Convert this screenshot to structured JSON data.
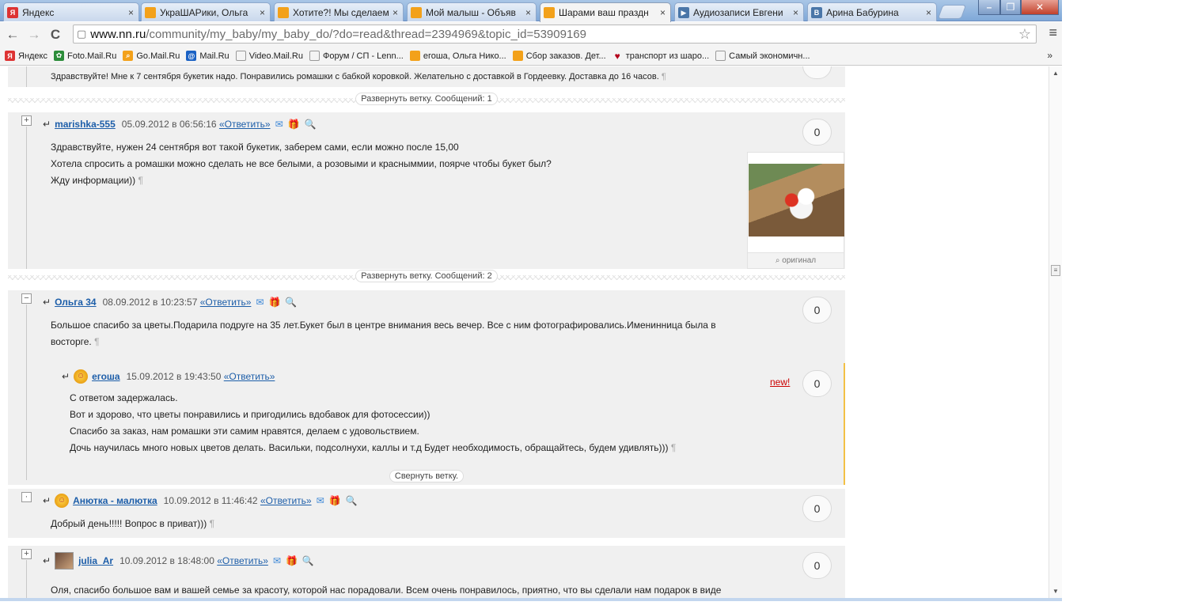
{
  "tabs": [
    {
      "label": "Яндекс",
      "fav": "Я",
      "fav_color": "#d33"
    },
    {
      "label": "УкраШАРики, Ольга",
      "fav": "",
      "fav_color": "#f3a11a"
    },
    {
      "label": "Хотите?! Мы сделаем",
      "fav": "",
      "fav_color": "#f3a11a"
    },
    {
      "label": "Мой малыш - Объяв",
      "fav": "",
      "fav_color": "#f3a11a"
    },
    {
      "label": "Шарами ваш праздн",
      "fav": "",
      "fav_color": "#f3a11a"
    },
    {
      "label": "Аудиозаписи Евгени",
      "fav": "▶",
      "fav_color": "#4a76a8"
    },
    {
      "label": "Арина Бабурина",
      "fav": "В",
      "fav_color": "#4a76a8"
    }
  ],
  "window": {
    "minimize": "–",
    "maximize": "❐",
    "close": "✕"
  },
  "toolbar": {
    "back": "←",
    "forward": "→",
    "reload": "C",
    "url_host": "www.nn.ru",
    "url_path": "/community/my_baby/my_baby_do/?do=read&thread=2394969&topic_id=53909169",
    "star": "☆",
    "menu": "≡"
  },
  "bookmarks": [
    {
      "label": "Яндекс",
      "ico": "Я",
      "color": "#d33"
    },
    {
      "label": "Foto.Mail.Ru",
      "ico": "✿",
      "color": "#2c8c3a"
    },
    {
      "label": "Go.Mail.Ru",
      "ico": "⌕",
      "color": "#f3a11a"
    },
    {
      "label": "Mail.Ru",
      "ico": "@",
      "color": "#1b62c4"
    },
    {
      "label": "Video.Mail.Ru",
      "ico": "▢",
      "color": "#999"
    },
    {
      "label": "Форум / СП - Lenn...",
      "ico": "▢",
      "color": "#999"
    },
    {
      "label": "егоша, Ольга Нико...",
      "ico": "",
      "color": "#f3a11a"
    },
    {
      "label": "Сбор заказов. Дет...",
      "ico": "",
      "color": "#f3a11a"
    },
    {
      "label": "транспорт из шаро...",
      "ico": "♥",
      "color": "#b3001b"
    },
    {
      "label": "Самый экономичн...",
      "ico": "▢",
      "color": "#999"
    }
  ],
  "bookmarks_more": "»",
  "top_post": {
    "text": "Здравствуйте! Мне к 7 сентября букетик надо. Понравились ромашки с бабкой коровкой. Желательно с доставкой в Гордеевку. Доставка до 16 часов."
  },
  "expand1": "Развернуть ветку. Сообщений: 1",
  "expand2": "Развернуть ветку. Сообщений: 2",
  "collapse": "Свернуть ветку.",
  "pilcrow": "¶",
  "reply_label": "«Ответить»",
  "posts": [
    {
      "toggle": "+",
      "author": "marishka-555",
      "date": "05.09.2012 в 06:56:16",
      "votes": "0",
      "lines": [
        "Здравствуйте, нужен 24 сентября вот такой букетик, заберем сами, если можно после 15,00",
        "Хотела спросить а ромашки можно сделать не все белыми, а розовыми и красныммии, поярче чтобы букет был?",
        "Жду информации))"
      ],
      "thumb_caption": "⌕ оригинал"
    },
    {
      "toggle": "−",
      "author": "Ольга 34",
      "date": "08.09.2012 в 10:23:57",
      "votes": "0",
      "lines": [
        "Большое спасибо за цветы.Подарила подруге на 35 лет.Букет был в центре внимания весь вечер. Все с ним фотографировались.Именинница была в",
        "восторге."
      ]
    },
    {
      "author": "егоша",
      "date": "15.09.2012 в 19:43:50",
      "votes": "0",
      "new": "new!",
      "lines": [
        "С ответом задержалась.",
        "Вот и здорово, что цветы понравились и пригодились вдобавок для фотосессии))",
        "Спасибо за заказ, нам ромашки эти самим нравятся, делаем с удовольствием.",
        "Дочь научилась много новых цветов делать. Васильки, подсолнухи, каллы и т.д Будет необходимость, обращайтесь, будем удивлять)))"
      ]
    },
    {
      "toggle": "·",
      "author": "Анютка - малютка",
      "date": "10.09.2012 в 11:46:42",
      "votes": "0",
      "lines": [
        "Добрый день!!!!! Вопрос в приват)))"
      ]
    },
    {
      "toggle": "+",
      "author": "julia_Ar",
      "date": "10.09.2012 в 18:48:00",
      "votes": "0",
      "lines": [
        "Оля, спасибо большое вам и вашей семье за красоту, которой нас порадовали. Всем очень понравилось, приятно, что вы сделали нам подарок в виде"
      ]
    }
  ]
}
